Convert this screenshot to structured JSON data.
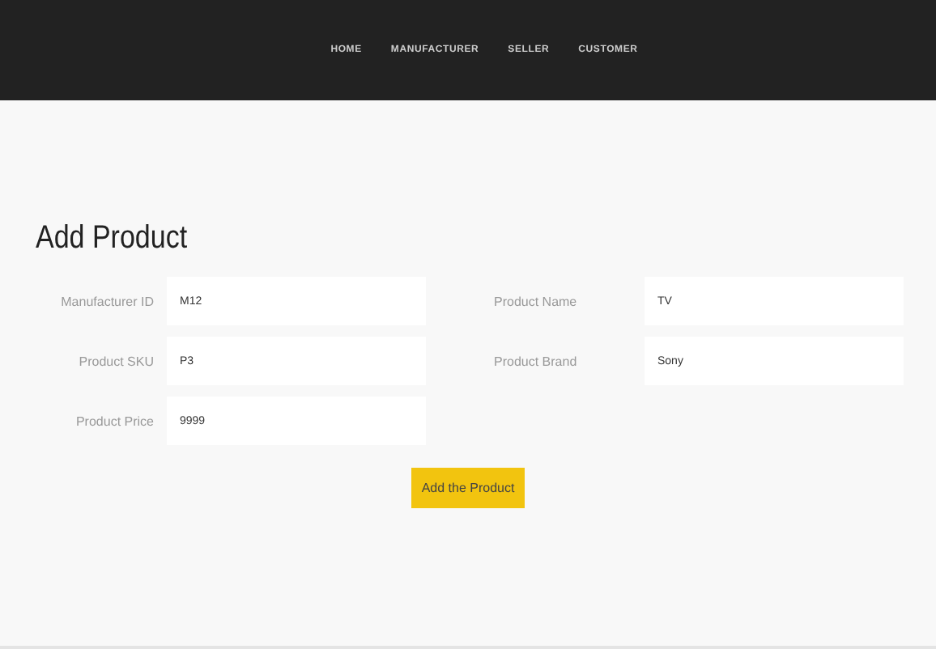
{
  "nav": {
    "items": [
      {
        "label": "HOME"
      },
      {
        "label": "MANUFACTURER"
      },
      {
        "label": "SELLER"
      },
      {
        "label": "CUSTOMER"
      }
    ]
  },
  "form": {
    "title": "Add Product",
    "left_fields": [
      {
        "label": "Manufacturer ID",
        "value": "M12"
      },
      {
        "label": "Product SKU",
        "value": "P3"
      },
      {
        "label": "Product Price",
        "value": "9999"
      }
    ],
    "right_fields": [
      {
        "label": "Product Name",
        "value": "TV"
      },
      {
        "label": "Product Brand",
        "value": "Sony"
      }
    ],
    "submit": "Add the Product"
  }
}
